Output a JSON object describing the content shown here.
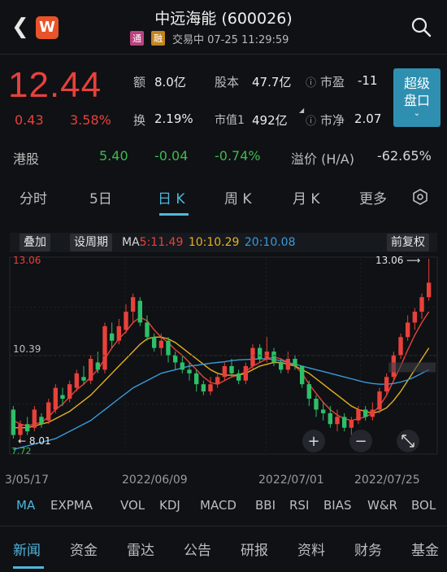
{
  "header": {
    "brand": "W",
    "title": "中远海能 (600026)",
    "tag_tong": "通",
    "tag_rong": "融",
    "status": "交易中 07-25 11:29:59"
  },
  "quote": {
    "price": "12.44",
    "change": "0.43",
    "change_pct": "3.58%",
    "amount_label": "额",
    "amount_value": "8.0亿",
    "shares_label": "股本",
    "shares_value": "47.7亿",
    "pe_label": "市盈",
    "pe_value": "-11",
    "turnover_label": "换",
    "turnover_value": "2.19%",
    "mcap_label": "市值1",
    "mcap_value": "492亿",
    "pb_label": "市净",
    "pb_value": "2.07",
    "super_line1": "超级",
    "super_line2": "盘口"
  },
  "hk": {
    "label": "港股",
    "price": "5.40",
    "change": "-0.04",
    "change_pct": "-0.74%",
    "premium_label": "溢价 (H/A)",
    "premium_value": "-62.65%"
  },
  "tabs": [
    "分时",
    "5日",
    "日 K",
    "周 K",
    "月 K",
    "更多"
  ],
  "chart_toolbar": {
    "overlay": "叠加",
    "period": "设周期",
    "ma_prefix": "MA",
    "ma5": "5:11.49",
    "ma10": "10:10.29",
    "ma20": "20:10.08",
    "adjust": "前复权"
  },
  "chart_data": {
    "type": "candlestick",
    "ylim": [
      7.72,
      13.06
    ],
    "y_labels": [
      "13.06",
      "10.39"
    ],
    "max_label": "13.06",
    "min_label": "8.01",
    "low_label": "7.72",
    "x_labels": [
      "3/05/17",
      "2022/06/09",
      "2022/07/01",
      "2022/07/25"
    ],
    "candles": [
      {
        "o": 8.9,
        "c": 8.2,
        "h": 9.0,
        "l": 8.1
      },
      {
        "o": 8.2,
        "c": 8.5,
        "h": 8.6,
        "l": 8.0
      },
      {
        "o": 8.5,
        "c": 8.3,
        "h": 8.7,
        "l": 8.2
      },
      {
        "o": 8.4,
        "c": 8.9,
        "h": 9.0,
        "l": 8.3
      },
      {
        "o": 8.7,
        "c": 8.5,
        "h": 8.8,
        "l": 8.4
      },
      {
        "o": 8.6,
        "c": 9.1,
        "h": 9.2,
        "l": 8.5
      },
      {
        "o": 8.9,
        "c": 9.5,
        "h": 9.6,
        "l": 8.8
      },
      {
        "o": 9.3,
        "c": 9.2,
        "h": 9.5,
        "l": 9.0
      },
      {
        "o": 9.2,
        "c": 9.6,
        "h": 9.7,
        "l": 9.1
      },
      {
        "o": 9.5,
        "c": 9.9,
        "h": 10.0,
        "l": 9.4
      },
      {
        "o": 9.8,
        "c": 9.7,
        "h": 10.1,
        "l": 9.6
      },
      {
        "o": 9.7,
        "c": 10.3,
        "h": 10.4,
        "l": 9.6
      },
      {
        "o": 10.2,
        "c": 10.0,
        "h": 10.5,
        "l": 9.9
      },
      {
        "o": 10.0,
        "c": 11.2,
        "h": 11.3,
        "l": 9.9
      },
      {
        "o": 11.0,
        "c": 10.8,
        "h": 11.3,
        "l": 10.6
      },
      {
        "o": 10.8,
        "c": 11.2,
        "h": 11.4,
        "l": 10.7
      },
      {
        "o": 11.1,
        "c": 11.6,
        "h": 11.8,
        "l": 11.0
      },
      {
        "o": 11.6,
        "c": 12.0,
        "h": 12.1,
        "l": 11.3
      },
      {
        "o": 11.9,
        "c": 11.3,
        "h": 12.0,
        "l": 11.2
      },
      {
        "o": 11.3,
        "c": 10.9,
        "h": 11.5,
        "l": 10.8
      },
      {
        "o": 10.9,
        "c": 10.6,
        "h": 11.0,
        "l": 10.5
      },
      {
        "o": 10.6,
        "c": 10.8,
        "h": 11.0,
        "l": 10.4
      },
      {
        "o": 10.8,
        "c": 10.4,
        "h": 10.9,
        "l": 10.2
      },
      {
        "o": 10.4,
        "c": 10.2,
        "h": 10.5,
        "l": 10.0
      },
      {
        "o": 10.2,
        "c": 10.0,
        "h": 10.4,
        "l": 9.9
      },
      {
        "o": 10.0,
        "c": 9.9,
        "h": 10.2,
        "l": 9.7
      },
      {
        "o": 9.9,
        "c": 9.6,
        "h": 10.0,
        "l": 9.4
      },
      {
        "o": 9.6,
        "c": 9.4,
        "h": 9.7,
        "l": 9.3
      },
      {
        "o": 9.4,
        "c": 9.6,
        "h": 9.8,
        "l": 9.3
      },
      {
        "o": 9.6,
        "c": 9.8,
        "h": 9.9,
        "l": 9.5
      },
      {
        "o": 9.8,
        "c": 10.1,
        "h": 10.2,
        "l": 9.7
      },
      {
        "o": 10.1,
        "c": 9.9,
        "h": 10.3,
        "l": 9.8
      },
      {
        "o": 9.9,
        "c": 9.7,
        "h": 10.0,
        "l": 9.6
      },
      {
        "o": 9.7,
        "c": 10.1,
        "h": 10.2,
        "l": 9.6
      },
      {
        "o": 10.1,
        "c": 10.6,
        "h": 10.7,
        "l": 10.0
      },
      {
        "o": 10.6,
        "c": 10.3,
        "h": 10.7,
        "l": 10.2
      },
      {
        "o": 10.3,
        "c": 10.5,
        "h": 10.9,
        "l": 10.2
      },
      {
        "o": 10.5,
        "c": 10.2,
        "h": 10.6,
        "l": 10.1
      },
      {
        "o": 10.2,
        "c": 10.0,
        "h": 10.3,
        "l": 9.9
      },
      {
        "o": 10.0,
        "c": 10.3,
        "h": 10.5,
        "l": 9.9
      },
      {
        "o": 10.3,
        "c": 10.1,
        "h": 10.4,
        "l": 10.0
      },
      {
        "o": 10.1,
        "c": 9.6,
        "h": 10.1,
        "l": 9.5
      },
      {
        "o": 9.6,
        "c": 9.2,
        "h": 9.7,
        "l": 9.0
      },
      {
        "o": 9.2,
        "c": 8.9,
        "h": 9.3,
        "l": 8.7
      },
      {
        "o": 8.9,
        "c": 8.8,
        "h": 9.1,
        "l": 8.6
      },
      {
        "o": 8.8,
        "c": 8.5,
        "h": 9.0,
        "l": 8.4
      },
      {
        "o": 8.5,
        "c": 8.7,
        "h": 8.9,
        "l": 8.3
      },
      {
        "o": 8.7,
        "c": 8.4,
        "h": 8.8,
        "l": 8.3
      },
      {
        "o": 8.4,
        "c": 8.6,
        "h": 8.7,
        "l": 8.2
      },
      {
        "o": 8.6,
        "c": 8.9,
        "h": 9.0,
        "l": 8.5
      },
      {
        "o": 8.9,
        "c": 8.7,
        "h": 9.0,
        "l": 8.6
      },
      {
        "o": 8.7,
        "c": 8.9,
        "h": 9.1,
        "l": 8.6
      },
      {
        "o": 8.9,
        "c": 9.4,
        "h": 9.5,
        "l": 8.8
      },
      {
        "o": 9.4,
        "c": 9.8,
        "h": 9.9,
        "l": 9.3
      },
      {
        "o": 9.8,
        "c": 10.4,
        "h": 10.5,
        "l": 9.7
      },
      {
        "o": 10.4,
        "c": 10.9,
        "h": 11.0,
        "l": 10.3
      },
      {
        "o": 10.9,
        "c": 11.3,
        "h": 11.5,
        "l": 10.8
      },
      {
        "o": 11.3,
        "c": 11.6,
        "h": 11.7,
        "l": 11.1
      },
      {
        "o": 11.6,
        "c": 12.0,
        "h": 12.1,
        "l": 11.4
      },
      {
        "o": 12.0,
        "c": 12.4,
        "h": 13.06,
        "l": 11.9
      }
    ],
    "series": [
      {
        "name": "MA5",
        "color": "#e8413b",
        "values": [
          8.6,
          8.5,
          8.45,
          8.5,
          8.55,
          8.7,
          8.9,
          9.05,
          9.25,
          9.45,
          9.6,
          9.8,
          10.0,
          10.3,
          10.6,
          10.85,
          11.05,
          11.3,
          11.45,
          11.35,
          11.1,
          10.9,
          10.75,
          10.55,
          10.4,
          10.2,
          10.0,
          9.8,
          9.65,
          9.6,
          9.7,
          9.8,
          9.85,
          9.95,
          10.1,
          10.2,
          10.3,
          10.35,
          10.3,
          10.2,
          10.1,
          9.9,
          9.6,
          9.35,
          9.1,
          8.9,
          8.75,
          8.65,
          8.6,
          8.65,
          8.7,
          8.8,
          9.0,
          9.3,
          9.7,
          10.1,
          10.55,
          10.95,
          11.3,
          11.6
        ]
      },
      {
        "name": "MA10",
        "color": "#e6b024",
        "values": [
          8.4,
          8.4,
          8.4,
          8.45,
          8.5,
          8.55,
          8.65,
          8.75,
          8.85,
          9.0,
          9.15,
          9.3,
          9.5,
          9.7,
          9.9,
          10.1,
          10.3,
          10.5,
          10.7,
          10.85,
          10.9,
          10.9,
          10.85,
          10.75,
          10.6,
          10.45,
          10.3,
          10.15,
          10.0,
          9.9,
          9.85,
          9.85,
          9.85,
          9.9,
          10.0,
          10.1,
          10.15,
          10.2,
          10.2,
          10.15,
          10.1,
          10.0,
          9.9,
          9.75,
          9.6,
          9.45,
          9.3,
          9.15,
          9.0,
          8.9,
          8.85,
          8.8,
          8.85,
          8.95,
          9.15,
          9.4,
          9.7,
          10.0,
          10.3,
          10.6
        ]
      },
      {
        "name": "MA20",
        "color": "#3a9ad9",
        "values": [
          7.8,
          7.85,
          7.9,
          7.95,
          8.0,
          8.05,
          8.1,
          8.2,
          8.3,
          8.4,
          8.5,
          8.6,
          8.75,
          8.9,
          9.05,
          9.2,
          9.35,
          9.5,
          9.6,
          9.7,
          9.8,
          9.9,
          9.95,
          10.0,
          10.05,
          10.1,
          10.12,
          10.15,
          10.18,
          10.2,
          10.22,
          10.25,
          10.27,
          10.28,
          10.29,
          10.3,
          10.3,
          10.28,
          10.25,
          10.2,
          10.15,
          10.1,
          10.05,
          10.0,
          9.95,
          9.9,
          9.85,
          9.8,
          9.75,
          9.7,
          9.65,
          9.62,
          9.6,
          9.6,
          9.62,
          9.66,
          9.72,
          9.8,
          9.9,
          10.0
        ]
      }
    ]
  },
  "zoom": {
    "plus": "+",
    "minus": "−"
  },
  "indicators": [
    "MA",
    "EXPMA",
    "VOL",
    "KDJ",
    "MACD",
    "BBI",
    "RSI",
    "BIAS",
    "W&R",
    "BOL"
  ],
  "news_tabs": [
    "新闻",
    "资金",
    "雷达",
    "公告",
    "研报",
    "资料",
    "财务",
    "基金"
  ],
  "colors": {
    "up": "#e8413b",
    "down": "#2ebf68",
    "accent": "#4fb6dc"
  }
}
